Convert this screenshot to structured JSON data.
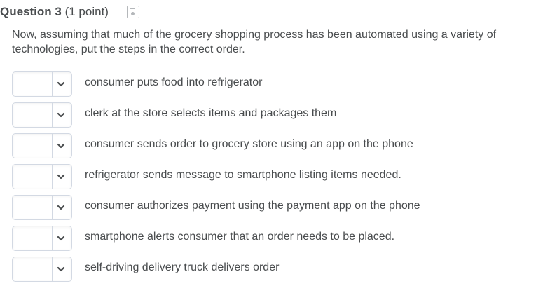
{
  "question": {
    "number_label": "Question 3",
    "points_label": "(1 point)",
    "save_icon": "save-icon",
    "prompt": "Now, assuming that much of the grocery shopping process has been automated using a variety of technologies, put the steps in the correct order."
  },
  "ordering": {
    "items": [
      {
        "selected": "",
        "label": "consumer puts food into refrigerator"
      },
      {
        "selected": "",
        "label": "clerk at the store selects items and packages them"
      },
      {
        "selected": "",
        "label": "consumer sends order to grocery store using an app on the phone"
      },
      {
        "selected": "",
        "label": "refrigerator sends message to smartphone listing items needed."
      },
      {
        "selected": "",
        "label": "consumer authorizes payment using the payment app on the phone"
      },
      {
        "selected": "",
        "label": "smartphone alerts consumer that an order needs to be placed."
      },
      {
        "selected": "",
        "label": "self-driving delivery truck delivers order"
      }
    ]
  },
  "colors": {
    "text": "#494c4e",
    "border": "#d3d9e3",
    "chevron": "#494c4e"
  }
}
